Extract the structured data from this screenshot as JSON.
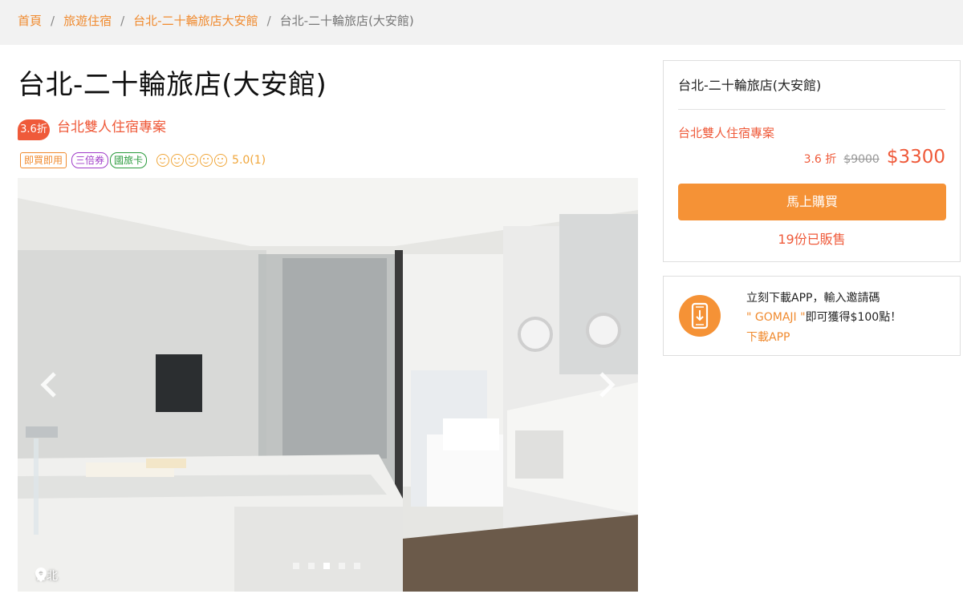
{
  "breadcrumb": {
    "items": [
      "首頁",
      "旅遊住宿",
      "台北-二十輪旅店大安館"
    ],
    "current": "台北-二十輪旅店(大安館)",
    "separator": "/"
  },
  "product": {
    "title": "台北-二十輪旅店(大安館)",
    "discount_badge": "3.6折",
    "plan_name": "台北雙人住宿專案",
    "tags": [
      "即買即用",
      "三倍券",
      "國旅卡"
    ],
    "rating_text": "5.0(1)"
  },
  "gallery": {
    "location": "台北",
    "slide_count": 5,
    "active_index": 2
  },
  "buy_card": {
    "hotel_name": "台北-二十輪旅店(大安館)",
    "plan_name": "台北雙人住宿專案",
    "discount": "3.6 折",
    "original_price": "$9000",
    "price": "$3300",
    "buy_label": "馬上購買",
    "sold_text": "19份已販售"
  },
  "app_card": {
    "line1": "立刻下載APP，輸入邀請碼",
    "code": "\" GOMAJI \"",
    "line2_rest": "即可獲得$100點！",
    "link": "下載APP",
    "icon": "phone-download-icon"
  },
  "colors": {
    "accent": "#f59236",
    "price_red": "#ef5a3a",
    "link_orange": "#f08a2e",
    "breadcrumb_bg": "#f2f2f2"
  }
}
